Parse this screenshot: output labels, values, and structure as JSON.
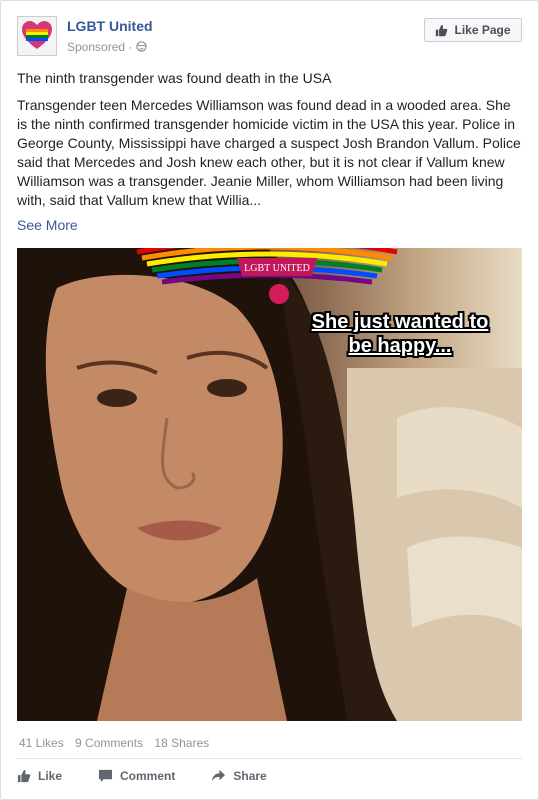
{
  "post": {
    "page_name": "LGBT United",
    "sponsored_label": "Sponsored",
    "visibility_sep": "·",
    "like_page_label": "Like Page",
    "headline": "The ninth transgender was found death in the USA",
    "body": "Transgender teen Mercedes Williamson was found dead in a wooded area. She is the ninth confirmed transgender homicide victim in the USA this year. Police in George County, Mississippi have charged a suspect Josh Brandon Vallum. Police said that Mercedes and Josh knew each other, but it is not clear if Vallum knew Williamson was a transgender. Jeanie Miller, whom Williamson had been living with, said that Vallum knew that Willia...",
    "see_more_label": "See More"
  },
  "image": {
    "logo_text": "LGBT UNITED",
    "overlay_text": "She just wanted to be happy..."
  },
  "stats": {
    "likes": "41 Likes",
    "comments": "9 Comments",
    "shares": "18 Shares"
  },
  "actions": {
    "like_label": "Like",
    "comment_label": "Comment",
    "share_label": "Share"
  },
  "colors": {
    "link": "#365899",
    "muted": "#90949c",
    "rainbow": [
      "#e40303",
      "#ff8c00",
      "#ffed00",
      "#008026",
      "#004dff",
      "#750787"
    ]
  }
}
